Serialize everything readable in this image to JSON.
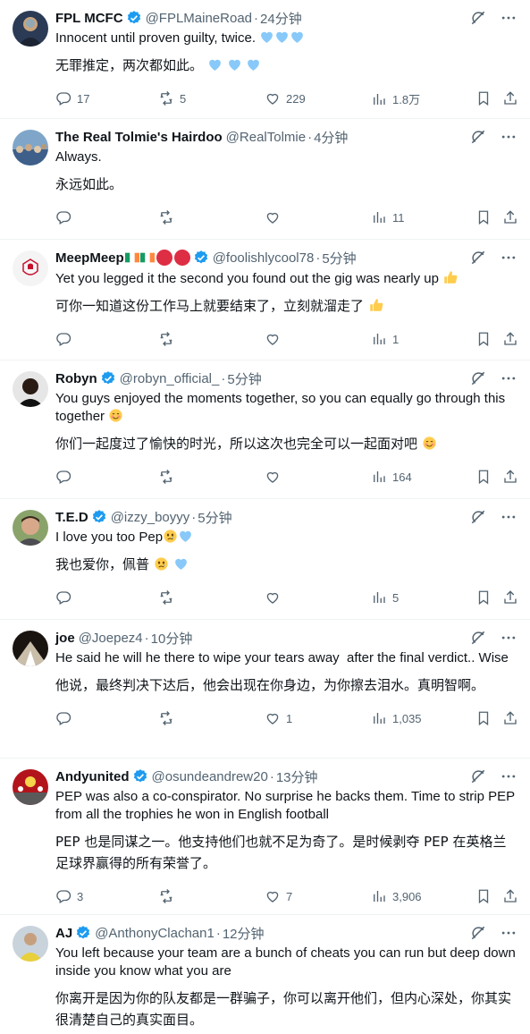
{
  "tweets": [
    {
      "name": "FPL MCFC",
      "handle": "@FPLMaineRoad",
      "time": "24分钟",
      "text": "Innocent until proven guilty, twice. ",
      "translation": "无罪推定，两次都如此。 ",
      "replies": "17",
      "retweets": "5",
      "likes": "229",
      "views": "1.8万",
      "avatar": "mcfc-avatar"
    },
    {
      "name": "The Real Tolmie's Hairdoo",
      "handle": "@RealTolmie",
      "time": "4分钟",
      "text": "Always.",
      "translation": "永远如此。",
      "replies": "",
      "retweets": "",
      "likes": "",
      "views": "11",
      "avatar": "crowd-avatar"
    },
    {
      "name": "MeepMeep",
      "handle": "@foolishlycool78",
      "time": "5分钟",
      "text": "Yet you legged it the second you found out the gig was nearly up ",
      "translation": "可你一知道这份工作马上就要结束了，立刻就溜走了 ",
      "replies": "",
      "retweets": "",
      "likes": "",
      "views": "1",
      "avatar": "lfc-crest-avatar"
    },
    {
      "name": "Robyn",
      "handle": "@robyn_official_",
      "time": "5分钟",
      "text": "You guys enjoyed the moments together, so you can equally go through this together ",
      "translation": "你们一起度过了愉快的时光，所以这次也完全可以一起面对吧 ",
      "replies": "",
      "retweets": "",
      "likes": "",
      "views": "164",
      "avatar": "person-avatar"
    },
    {
      "name": "T.E.D",
      "handle": "@izzy_boyyy",
      "time": "5分钟",
      "text": "I love you too Pep",
      "translation": "我也爱你，佩普 ",
      "replies": "",
      "retweets": "",
      "likes": "",
      "views": "5",
      "avatar": "man-avatar"
    },
    {
      "name": "joe",
      "handle": "@Joepez4",
      "time": "10分钟",
      "text": "He said he will he there to wipe your tears away  after the final verdict.. Wise",
      "translation": "他说，最终判决下达后，他会出现在你身边，为你擦去泪水。真明智啊。",
      "replies": "",
      "retweets": "",
      "likes": "1",
      "views": "1,035",
      "avatar": "tunnel-avatar"
    },
    {
      "name": "Andyunited",
      "handle": "@osundeandrew20",
      "time": "13分钟",
      "text": "PEP was also a co-conspirator. No surprise he backs them. Time to strip PEP from all the trophies he won in English football",
      "translation": "PEP 也是同谋之一。他支持他们也就不足为奇了。是时候剥夺 PEP 在英格兰足球界赢得的所有荣誉了。",
      "replies": "3",
      "retweets": "",
      "likes": "7",
      "views": "3,906",
      "avatar": "mufc-avatar"
    },
    {
      "name": "AJ",
      "handle": "@AnthonyClachan1",
      "time": "12分钟",
      "text": "You left because your team are a bunch of cheats you can run but deep down inside you know what you are",
      "translation": "你离开是因为你的队友都是一群骗子，你可以离开他们，但内心深处，你其实很清楚自己的真实面目。",
      "avatar": "aj-avatar"
    }
  ],
  "icons": [
    "reply-icon",
    "retweet-icon",
    "like-icon",
    "views-icon",
    "bookmark-icon",
    "share-icon",
    "grok-icon",
    "more-icon",
    "verified-badge-icon"
  ],
  "colors": {
    "verified": "#1d9bf0",
    "muted": "#536471",
    "text": "#0f1419",
    "divider": "#eff3f4"
  }
}
